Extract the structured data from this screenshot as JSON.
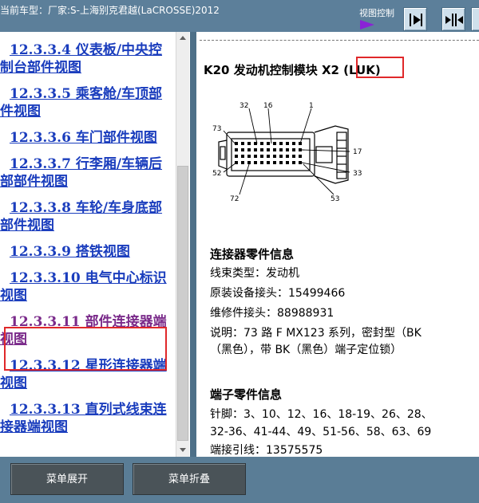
{
  "header": {
    "vehicle": "当前车型：厂家:S-上海别克君越(LaCROSSE)2012",
    "view_control_label": "视图控制"
  },
  "nav": {
    "items": [
      {
        "label": "12.3.3.4 仪表板/中央控制台部件视图",
        "visited": false
      },
      {
        "label": "12.3.3.5 乘客舱/车顶部件视图",
        "visited": false
      },
      {
        "label": "12.3.3.6 车门部件视图",
        "visited": false
      },
      {
        "label": "12.3.3.7 行李厢/车辆后部部件视图",
        "visited": false
      },
      {
        "label": "12.3.3.8 车轮/车身底部部件视图",
        "visited": false
      },
      {
        "label": "12.3.3.9 搭铁视图",
        "visited": false
      },
      {
        "label": "12.3.3.10 电气中心标识视图",
        "visited": false
      },
      {
        "label": "12.3.3.11 部件连接器端视图",
        "visited": true
      },
      {
        "label": "12.3.3.12 星形连接器端视图",
        "visited": false
      },
      {
        "label": "12.3.3.13 直列式线束连接器端视图",
        "visited": false
      }
    ]
  },
  "content": {
    "module_title": "K20 发动机控制模块 X2 (LUK)",
    "pin_labels": [
      "32",
      "16",
      "1",
      "73",
      "17",
      "52",
      "33",
      "72",
      "53"
    ],
    "connector_info_title": "连接器零件信息",
    "connector_info": [
      "线束类型：发动机",
      "原装设备接头：15499466",
      "维修件接头：88988931",
      "说明：73 路 F MX123 系列，密封型（BK",
      "（黑色），带 BK（黑色）端子定位锁）"
    ],
    "terminal_info_title": "端子零件信息",
    "terminal_info": [
      "针脚：3、10、12、16、18-19、26、28、",
      "32-36、41-44、49、51-56、58、63、69",
      "端接引线：13575575"
    ]
  },
  "footer": {
    "expand_label": "菜单展开",
    "collapse_label": "菜单折叠"
  },
  "colors": {
    "header_bg": "#5c7f9a",
    "link": "#1a3dbd",
    "visited_link": "#7a2a8a",
    "highlight": "#e0282a",
    "button_bg": "#4a5358"
  }
}
